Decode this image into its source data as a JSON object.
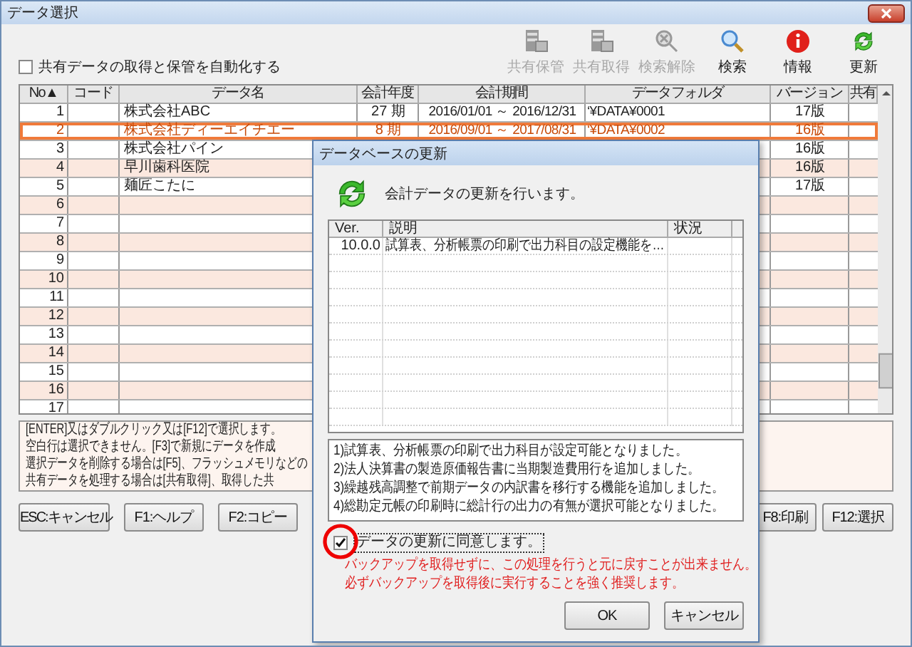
{
  "window": {
    "title": "データ選択"
  },
  "auto_share": {
    "label": "共有データの取得と保管を自動化する",
    "checked": false
  },
  "toolbar": [
    {
      "label": "共有保管",
      "kind": "server",
      "disabled": true
    },
    {
      "label": "共有取得",
      "kind": "server",
      "disabled": true
    },
    {
      "label": "検索解除",
      "kind": "clear",
      "disabled": true
    },
    {
      "label": "検索",
      "kind": "search",
      "disabled": false
    },
    {
      "label": "情報",
      "kind": "info",
      "disabled": false
    },
    {
      "label": "更新",
      "kind": "update",
      "disabled": false
    }
  ],
  "table": {
    "columns": [
      "No▲",
      "コード",
      "データ名",
      "会計年度",
      "会計期間",
      "データフォルダ",
      "バージョン",
      "共有"
    ],
    "rows": [
      {
        "no": "1",
        "name": "株式会社ABC",
        "year": "27 期",
        "period": "2016/01/01 ～ 2016/12/31",
        "folder": "‘¥DATA¥0001",
        "version": "17版",
        "selected": false
      },
      {
        "no": "2",
        "name": "株式会社ディーエイチエー",
        "year": "8 期",
        "period": "2016/09/01 ～ 2017/08/31",
        "folder": "‘¥DATA¥0002",
        "version": "16版",
        "selected": true
      },
      {
        "no": "3",
        "name": "株式会社パイン",
        "version": "16版",
        "selected": false
      },
      {
        "no": "4",
        "name": "早川歯科医院",
        "version": "16版",
        "selected": false
      },
      {
        "no": "5",
        "name": "麺匠こたに",
        "version": "17版",
        "selected": false
      },
      {
        "no": "6",
        "selected": false
      },
      {
        "no": "7",
        "selected": false
      },
      {
        "no": "8",
        "selected": false
      },
      {
        "no": "9",
        "selected": false
      },
      {
        "no": "10",
        "selected": false
      },
      {
        "no": "11",
        "selected": false
      },
      {
        "no": "12",
        "selected": false
      },
      {
        "no": "13",
        "selected": false
      },
      {
        "no": "14",
        "selected": false
      },
      {
        "no": "15",
        "selected": false
      },
      {
        "no": "16",
        "selected": false
      },
      {
        "no": "17",
        "selected": false
      }
    ]
  },
  "info": [
    "[ENTER]又はダブルクリック又は[F12]で選択します。",
    "空白行は選択できません。[F3]で新規にデータを作成",
    "選択データを削除する場合は[F5]、フラッシュメモリなどの",
    "共有データを処理する場合は[共有取得]、取得した共"
  ],
  "buttons_left": [
    "ESC:キャンセル",
    "F1:ヘルプ",
    "F2:コピー"
  ],
  "buttons_right": [
    "F8:印刷",
    "F12:選択"
  ],
  "dialog": {
    "title": "データベースの更新",
    "message": "会計データの更新を行います。",
    "columns": [
      "Ver.",
      "説明",
      "状況"
    ],
    "rows": [
      {
        "ver": "10.0.0",
        "description": "試算表、分析帳票の印刷で出力科目の設定機能を…"
      }
    ],
    "details": [
      "1)試算表、分析帳票の印刷で出力科目が設定可能となりました。",
      "2)法人決算書の製造原価報告書に当期製造費用行を追加しました。",
      "3)繰越残高調整で前期データの内訳書を移行する機能を追加しました。",
      "4)総勘定元帳の印刷時に総計行の出力の有無が選択可能となりました。"
    ],
    "agree": {
      "label": "データの更新に同意します。",
      "checked": true
    },
    "warnings": [
      "バックアップを取得せずに、この処理を行うと元に戻すことが出来ません。",
      "必ずバックアップを取得後に実行することを強く推奨します。"
    ],
    "buttons": [
      "OK",
      "キャンセル"
    ]
  }
}
